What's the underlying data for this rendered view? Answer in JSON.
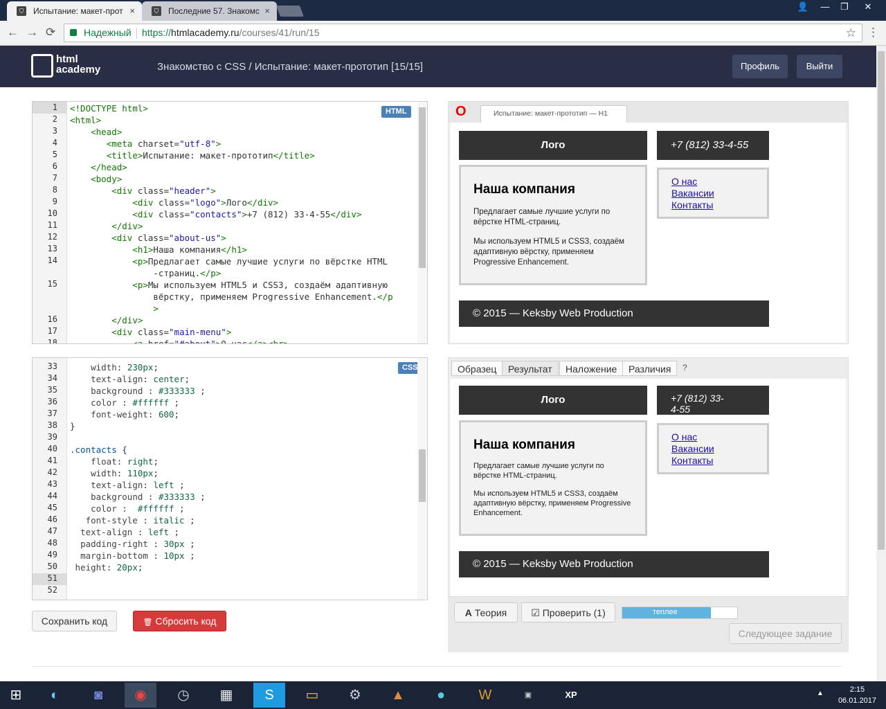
{
  "browser": {
    "tabs": [
      {
        "title": "Испытание: макет-прот",
        "close": "×"
      },
      {
        "title": "Последние 57. Знакомс",
        "close": "×"
      }
    ],
    "window_buttons": [
      "👤",
      "—",
      "❐",
      "✕"
    ],
    "nav": {
      "back": "←",
      "forward": "→",
      "reload": "⟳"
    },
    "secure_label": "Надежный",
    "url_scheme": "https://",
    "url_domain": "htmlacademy.ru",
    "url_path": "/courses/41/run/15",
    "star": "☆",
    "menu": "⋮"
  },
  "site": {
    "logo_line1": "html",
    "logo_line2": "academy",
    "breadcrumb": "Знакомство с CSS / Испытание: макет-прототип [15/15]",
    "profile_button": "Профиль",
    "logout_button": "Выйти"
  },
  "html_editor": {
    "badge": "HTML",
    "line_numbers": [
      "1",
      "2",
      "3",
      "4",
      "5",
      "6",
      "7",
      "8",
      "9",
      "10",
      "11",
      "12",
      "13",
      "14",
      "",
      "15",
      "",
      "",
      "16",
      "17",
      "18"
    ]
  },
  "css_editor": {
    "badge": "CSS",
    "line_numbers": [
      "33",
      "34",
      "35",
      "36",
      "37",
      "38",
      "39",
      "40",
      "41",
      "42",
      "43",
      "44",
      "45",
      "46",
      "47",
      "48",
      "49",
      "50",
      "51",
      "52"
    ]
  },
  "buttons": {
    "save": "Сохранить код",
    "reset": "Сбросить код",
    "reset_icon": "🗑",
    "theory": "Теория",
    "theory_icon": "A",
    "check": "Проверить (1)",
    "check_icon": "☑",
    "next": "Следующее задание"
  },
  "preview_top": {
    "browser_icon": "O",
    "tab_title": "Испытание: макет-прототип — H1",
    "logo": "Лого",
    "contacts": "+7 (812) 33-4-55",
    "heading": "Наша компания",
    "p1": "Предлагает самые лучшие услуги по вёрстке HTML-страниц.",
    "p2": "Мы используем HTML5 и CSS3, создаём адаптивную вёрстку, применяем Progressive Enhancement.",
    "menu": [
      "О нас",
      "Вакансии",
      "Контакты"
    ],
    "footer": "© 2015 — Keksby Web Production"
  },
  "preview_bottom": {
    "tabs": [
      "Образец",
      "Результат",
      "Наложение",
      "Различия"
    ],
    "help": "?",
    "logo": "Лого",
    "contacts": "+7 (812) 33-4-55",
    "heading": "Наша компания",
    "p1": "Предлагает самые лучшие услуги по вёрстке HTML-страниц.",
    "p2": "Мы используем HTML5 и CSS3, создаём адаптивную вёрстку, применяем Progressive Enhancement.",
    "menu": [
      "О нас",
      "Вакансии",
      "Контакты"
    ],
    "footer": "© 2015 — Keksby Web Production"
  },
  "progress": {
    "label": "теплее",
    "value": 0.77
  },
  "taskbar": {
    "icons": [
      "windows-start",
      "browser-app",
      "discord",
      "chrome",
      "clock-app",
      "video-app",
      "skype",
      "file-explorer",
      "steam",
      "game-app",
      "orb-app",
      "warcraft",
      "unity",
      "xp-app"
    ],
    "time": "2:15",
    "date": "06.01.2017",
    "tray_arrow": "▲"
  },
  "colors": {
    "header_bg": "#2a2e45",
    "accent_green": "#0b8043",
    "badge_blue": "#4a81b6",
    "danger": "#d63a3a",
    "progress": "#5fb3de"
  }
}
